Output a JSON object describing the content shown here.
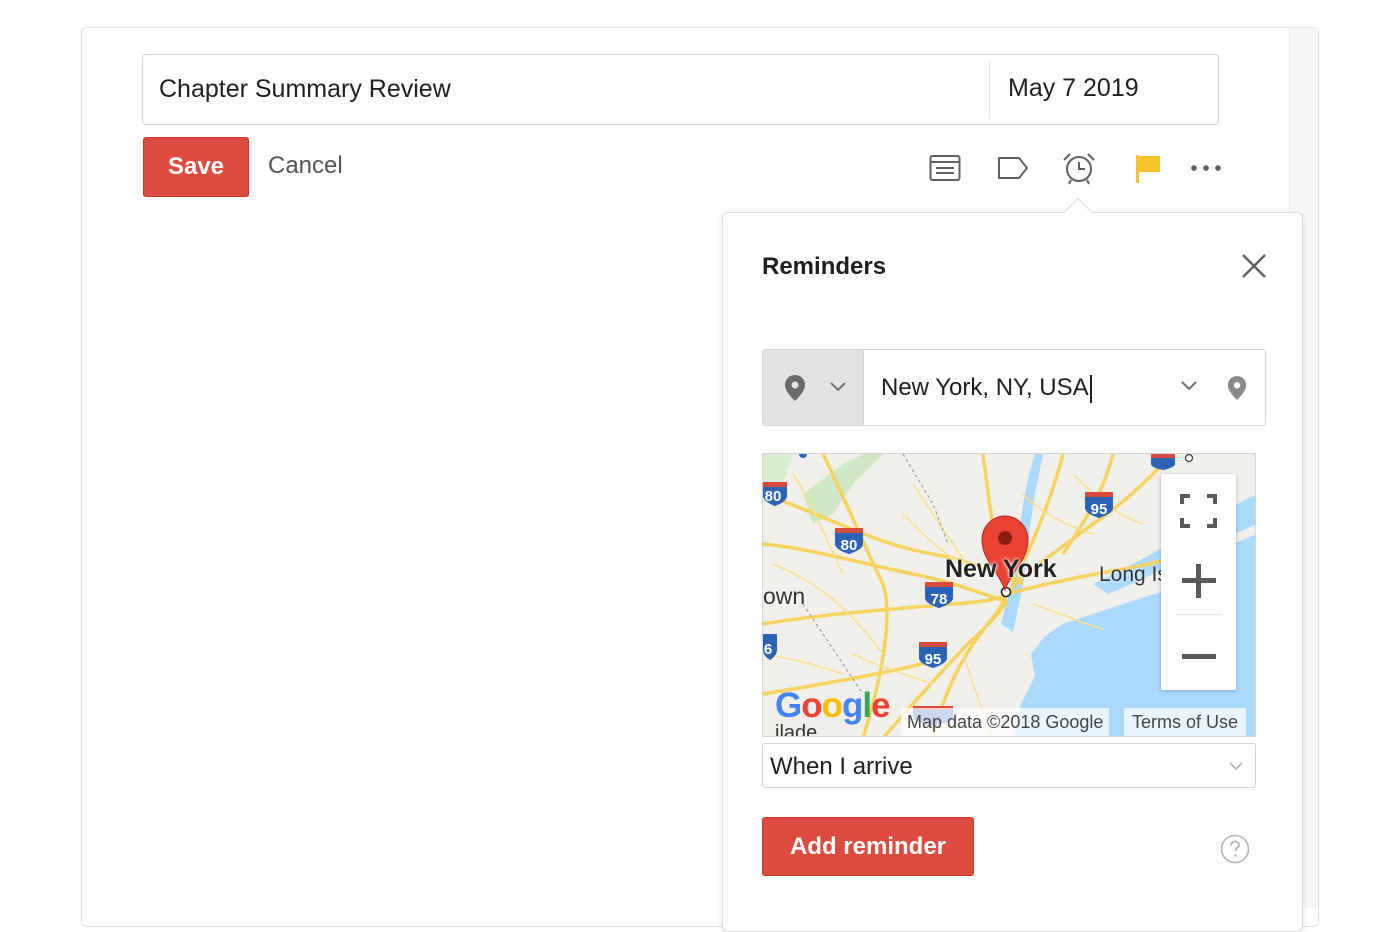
{
  "task": {
    "name": "Chapter Summary Review",
    "date": "May 7 2019"
  },
  "actions": {
    "save_label": "Save",
    "cancel_label": "Cancel"
  },
  "toolbar": {
    "icons": [
      "comment-icon",
      "label-icon",
      "alarm-clock-icon",
      "flag-icon",
      "more-icon"
    ],
    "flag_color": "#f5c52b"
  },
  "reminders": {
    "title": "Reminders",
    "location_value": "New York, NY, USA",
    "trigger_selected": "When I arrive",
    "add_label": "Add reminder"
  },
  "map": {
    "city_label": "New York",
    "place_labels": [
      "Long Is",
      "own",
      "ilade"
    ],
    "highway_shields": [
      "80",
      "80",
      "95",
      "95",
      "78",
      "95",
      "6"
    ],
    "logo": "Google",
    "attribution": "Map data ©2018 Google",
    "terms": "Terms of Use"
  },
  "colors": {
    "accent": "#db4c3f",
    "map_water": "#aadaff",
    "map_road": "#f6d35e",
    "pin": "#ea4335"
  }
}
